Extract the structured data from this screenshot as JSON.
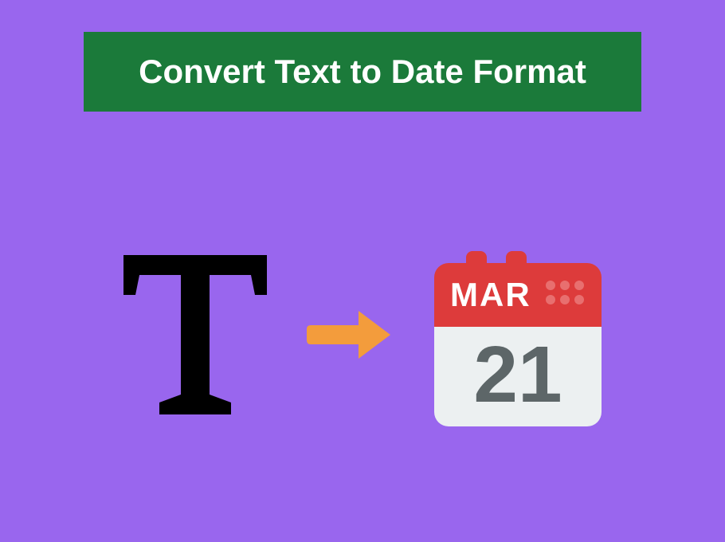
{
  "header": {
    "title": "Convert Text to Date Format"
  },
  "calendar": {
    "month": "MAR",
    "day": "21"
  },
  "colors": {
    "background": "#9966ee",
    "banner": "#1b7a3a",
    "bannerText": "#ffffff",
    "arrow": "#f39c3c",
    "calendarRed": "#dd3b3b",
    "calendarBody": "#ecf0f1",
    "calendarDay": "#5d6668"
  },
  "icons": {
    "text": "text-serif-T",
    "arrow": "arrow-right",
    "calendar": "calendar"
  }
}
